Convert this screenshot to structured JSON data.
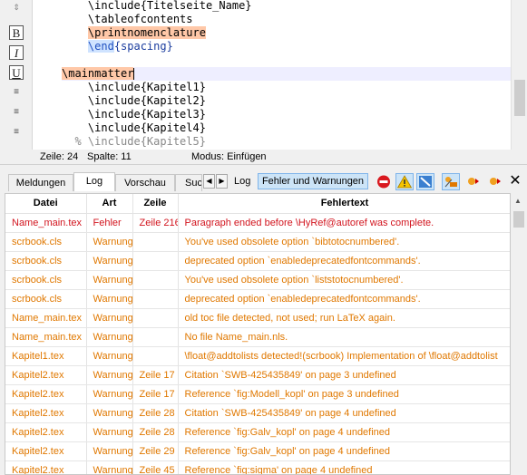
{
  "toolbar": {
    "bold": "B",
    "italic": "I",
    "underline": "U"
  },
  "editor": {
    "lines": [
      {
        "indent": "    ",
        "pre": "",
        "hl": "",
        "hl2": "",
        "text": "\\include{Titelseite_Name}"
      },
      {
        "indent": "    ",
        "pre": "",
        "hl": "",
        "hl2": "",
        "text": "\\tableofcontents"
      },
      {
        "indent": "    ",
        "pre": "",
        "hl": "\\printnomenclature",
        "hl2": "",
        "text": ""
      },
      {
        "indent": "    ",
        "pre": "",
        "hl": "",
        "hl2": "\\end",
        "text": "{spacing}"
      },
      {
        "indent": "",
        "pre": "",
        "hl": "",
        "hl2": "",
        "text": ""
      },
      {
        "indent": "",
        "pre": "",
        "hl": "\\mainmatter",
        "hl2": "",
        "text": ""
      },
      {
        "indent": "    ",
        "pre": "",
        "hl": "",
        "hl2": "",
        "text": "\\include{Kapitel1}"
      },
      {
        "indent": "    ",
        "pre": "",
        "hl": "",
        "hl2": "",
        "text": "\\include{Kapitel2}"
      },
      {
        "indent": "    ",
        "pre": "",
        "hl": "",
        "hl2": "",
        "text": "\\include{Kapitel3}"
      },
      {
        "indent": "    ",
        "pre": "",
        "hl": "",
        "hl2": "",
        "text": "\\include{Kapitel4}"
      },
      {
        "indent": "  ",
        "pre": "% \\include{Kapitel5}",
        "hl": "",
        "hl2": "",
        "text": ""
      }
    ]
  },
  "status": {
    "line": "Zeile: 24",
    "column": "Spalte: 11",
    "mode": "Modus: Einfügen"
  },
  "log_panel": {
    "tabs": [
      "Meldungen",
      "Log",
      "Vorschau",
      "Suc"
    ],
    "log_label": "Log",
    "filter_button": "Fehler und Warnungen",
    "close": "✕",
    "columns": [
      "Datei",
      "Art",
      "Zeile",
      "Fehlertext"
    ],
    "rows": [
      {
        "kind": "err",
        "file": "Name_main.tex",
        "type": "Fehler",
        "line": "Zeile 216",
        "msg": "Paragraph ended before \\HyRef@autoref was complete."
      },
      {
        "kind": "warn",
        "file": "scrbook.cls",
        "type": "Warnung",
        "line": "",
        "msg": "You've used obsolete option `bibtotocnumbered'."
      },
      {
        "kind": "warn",
        "file": "scrbook.cls",
        "type": "Warnung",
        "line": "",
        "msg": "deprecated option `enabledeprecatedfontcommands'."
      },
      {
        "kind": "warn",
        "file": "scrbook.cls",
        "type": "Warnung",
        "line": "",
        "msg": "You've used obsolete option `liststotocnumbered'."
      },
      {
        "kind": "warn",
        "file": "scrbook.cls",
        "type": "Warnung",
        "line": "",
        "msg": "deprecated option `enabledeprecatedfontcommands'."
      },
      {
        "kind": "warn",
        "file": "Name_main.tex",
        "type": "Warnung",
        "line": "",
        "msg": "old toc file detected, not used; run LaTeX again."
      },
      {
        "kind": "warn",
        "file": "Name_main.tex",
        "type": "Warnung",
        "line": "",
        "msg": "No file Name_main.nls."
      },
      {
        "kind": "warn",
        "file": "Kapitel1.tex",
        "type": "Warnung",
        "line": "",
        "msg": "\\float@addtolists detected!(scrbook) Implementation of \\float@addtolist"
      },
      {
        "kind": "warn",
        "file": "Kapitel2.tex",
        "type": "Warnung",
        "line": "Zeile 17",
        "msg": "Citation `SWB-425435849' on page 3 undefined"
      },
      {
        "kind": "warn",
        "file": "Kapitel2.tex",
        "type": "Warnung",
        "line": "Zeile 17",
        "msg": "Reference `fig:Modell_kopl' on page 3 undefined"
      },
      {
        "kind": "warn",
        "file": "Kapitel2.tex",
        "type": "Warnung",
        "line": "Zeile 28",
        "msg": "Citation `SWB-425435849' on page 4 undefined"
      },
      {
        "kind": "warn",
        "file": "Kapitel2.tex",
        "type": "Warnung",
        "line": "Zeile 28",
        "msg": "Reference `fig:Galv_kopl' on page 4 undefined"
      },
      {
        "kind": "warn",
        "file": "Kapitel2.tex",
        "type": "Warnung",
        "line": "Zeile 29",
        "msg": "Reference `fig:Galv_kopl' on page 4 undefined"
      },
      {
        "kind": "warn",
        "file": "Kapitel2.tex",
        "type": "Warnung",
        "line": "Zeile 45",
        "msg": "Reference `fig:sigma' on page 4 undefined"
      }
    ]
  },
  "colors": {
    "error": "#d2141e",
    "warning": "#e07800",
    "filter_active": "#cce4f7"
  }
}
